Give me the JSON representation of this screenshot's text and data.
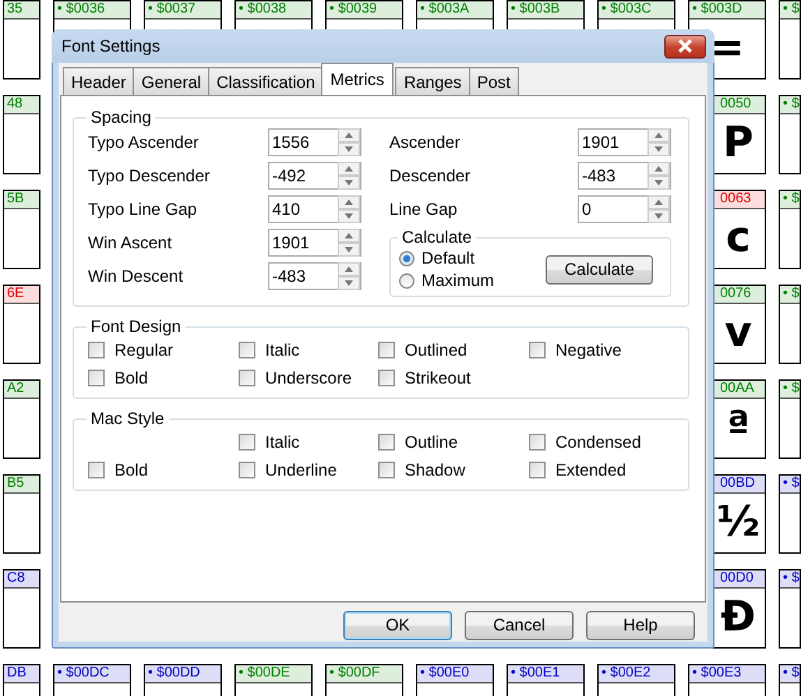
{
  "glyph_grid": {
    "top_row": [
      {
        "label": "35",
        "color": "#008000"
      },
      {
        "label": "• $0036",
        "color": "#008000"
      },
      {
        "label": "• $0037",
        "color": "#008000"
      },
      {
        "label": "• $0038",
        "color": "#008000"
      },
      {
        "label": "• $0039",
        "color": "#008000"
      },
      {
        "label": "• $003A",
        "color": "#008000"
      },
      {
        "label": "• $003B",
        "color": "#008000"
      },
      {
        "label": "• $003C",
        "color": "#008000"
      },
      {
        "label": "• $003D",
        "color": "#008000",
        "glyph": "="
      },
      {
        "label": "• $",
        "color": "#008000"
      }
    ],
    "left_column": [
      {
        "label": "48",
        "color": "#008000"
      },
      {
        "label": "5B",
        "color": "#008000"
      },
      {
        "label": "6E",
        "color": "#e00000"
      },
      {
        "label": "A2",
        "color": "#008000"
      },
      {
        "label": "B5",
        "color": "#008000"
      },
      {
        "label": "C8",
        "color": "#0000c0"
      }
    ],
    "right_column": [
      {
        "label": "0050",
        "color": "#008000",
        "glyph": "P"
      },
      {
        "label": "0063",
        "color": "#e00000",
        "glyph": "c"
      },
      {
        "label": "0076",
        "color": "#008000",
        "glyph": "v"
      },
      {
        "label": "00AA",
        "color": "#008000",
        "glyph": "ª"
      },
      {
        "label": "00BD",
        "color": "#0000c0",
        "glyph": "½"
      },
      {
        "label": "00D0",
        "color": "#0000c0",
        "glyph": "Ð"
      }
    ],
    "far_right_column": [
      {
        "label": "• $",
        "color": "#008000"
      },
      {
        "label": "• $",
        "color": "#008000"
      },
      {
        "label": "• $",
        "color": "#008000"
      },
      {
        "label": "• $",
        "color": "#008000"
      },
      {
        "label": "• $",
        "color": "#0000c0"
      },
      {
        "label": "• $",
        "color": "#0000c0"
      }
    ],
    "bottom_row": [
      {
        "label": "DB",
        "color": "#0000c0"
      },
      {
        "label": "• $00DC",
        "color": "#0000c0"
      },
      {
        "label": "• $00DD",
        "color": "#0000c0"
      },
      {
        "label": "• $00DE",
        "color": "#008000"
      },
      {
        "label": "• $00DF",
        "color": "#008000"
      },
      {
        "label": "• $00E0",
        "color": "#0000c0"
      },
      {
        "label": "• $00E1",
        "color": "#0000c0"
      },
      {
        "label": "• $00E2",
        "color": "#0000c0"
      },
      {
        "label": "• $00E3",
        "color": "#0000c0"
      },
      {
        "label": "• $",
        "color": "#0000c0"
      }
    ]
  },
  "window": {
    "title": "Font Settings"
  },
  "tabs": [
    {
      "label": "Header",
      "selected": false
    },
    {
      "label": "General",
      "selected": false
    },
    {
      "label": "Classification",
      "selected": false
    },
    {
      "label": "Metrics",
      "selected": true
    },
    {
      "label": "Ranges",
      "selected": false
    },
    {
      "label": "Post",
      "selected": false
    }
  ],
  "spacing": {
    "title": "Spacing",
    "left_fields": [
      {
        "label": "Typo Ascender",
        "value": "1556"
      },
      {
        "label": "Typo Descender",
        "value": "-492"
      },
      {
        "label": "Typo Line Gap",
        "value": "410"
      },
      {
        "label": "Win Ascent",
        "value": "1901"
      },
      {
        "label": "Win Descent",
        "value": "-483"
      }
    ],
    "right_fields": [
      {
        "label": "Ascender",
        "value": "1901"
      },
      {
        "label": "Descender",
        "value": "-483"
      },
      {
        "label": "Line Gap",
        "value": "0"
      }
    ],
    "calculate": {
      "title": "Calculate",
      "options": [
        {
          "label": "Default",
          "selected": true
        },
        {
          "label": "Maximum",
          "selected": false
        }
      ],
      "button": "Calculate"
    }
  },
  "font_design": {
    "title": "Font Design",
    "rows": [
      [
        {
          "label": "Regular",
          "checked": false
        },
        {
          "label": "Italic",
          "checked": false
        },
        {
          "label": "Outlined",
          "checked": false
        },
        {
          "label": "Negative",
          "checked": false
        }
      ],
      [
        {
          "label": "Bold",
          "checked": false
        },
        {
          "label": "Underscore",
          "checked": false
        },
        {
          "label": "Strikeout",
          "checked": false
        }
      ]
    ]
  },
  "mac_style": {
    "title": "Mac Style",
    "rows": [
      [
        "",
        {
          "label": "Italic",
          "checked": false
        },
        {
          "label": "Outline",
          "checked": false
        },
        {
          "label": "Condensed",
          "checked": false
        }
      ],
      [
        {
          "label": "Bold",
          "checked": false
        },
        {
          "label": "Underline",
          "checked": false
        },
        {
          "label": "Shadow",
          "checked": false
        },
        {
          "label": "Extended",
          "checked": false
        }
      ]
    ]
  },
  "buttons": [
    "OK",
    "Cancel",
    "Help"
  ]
}
